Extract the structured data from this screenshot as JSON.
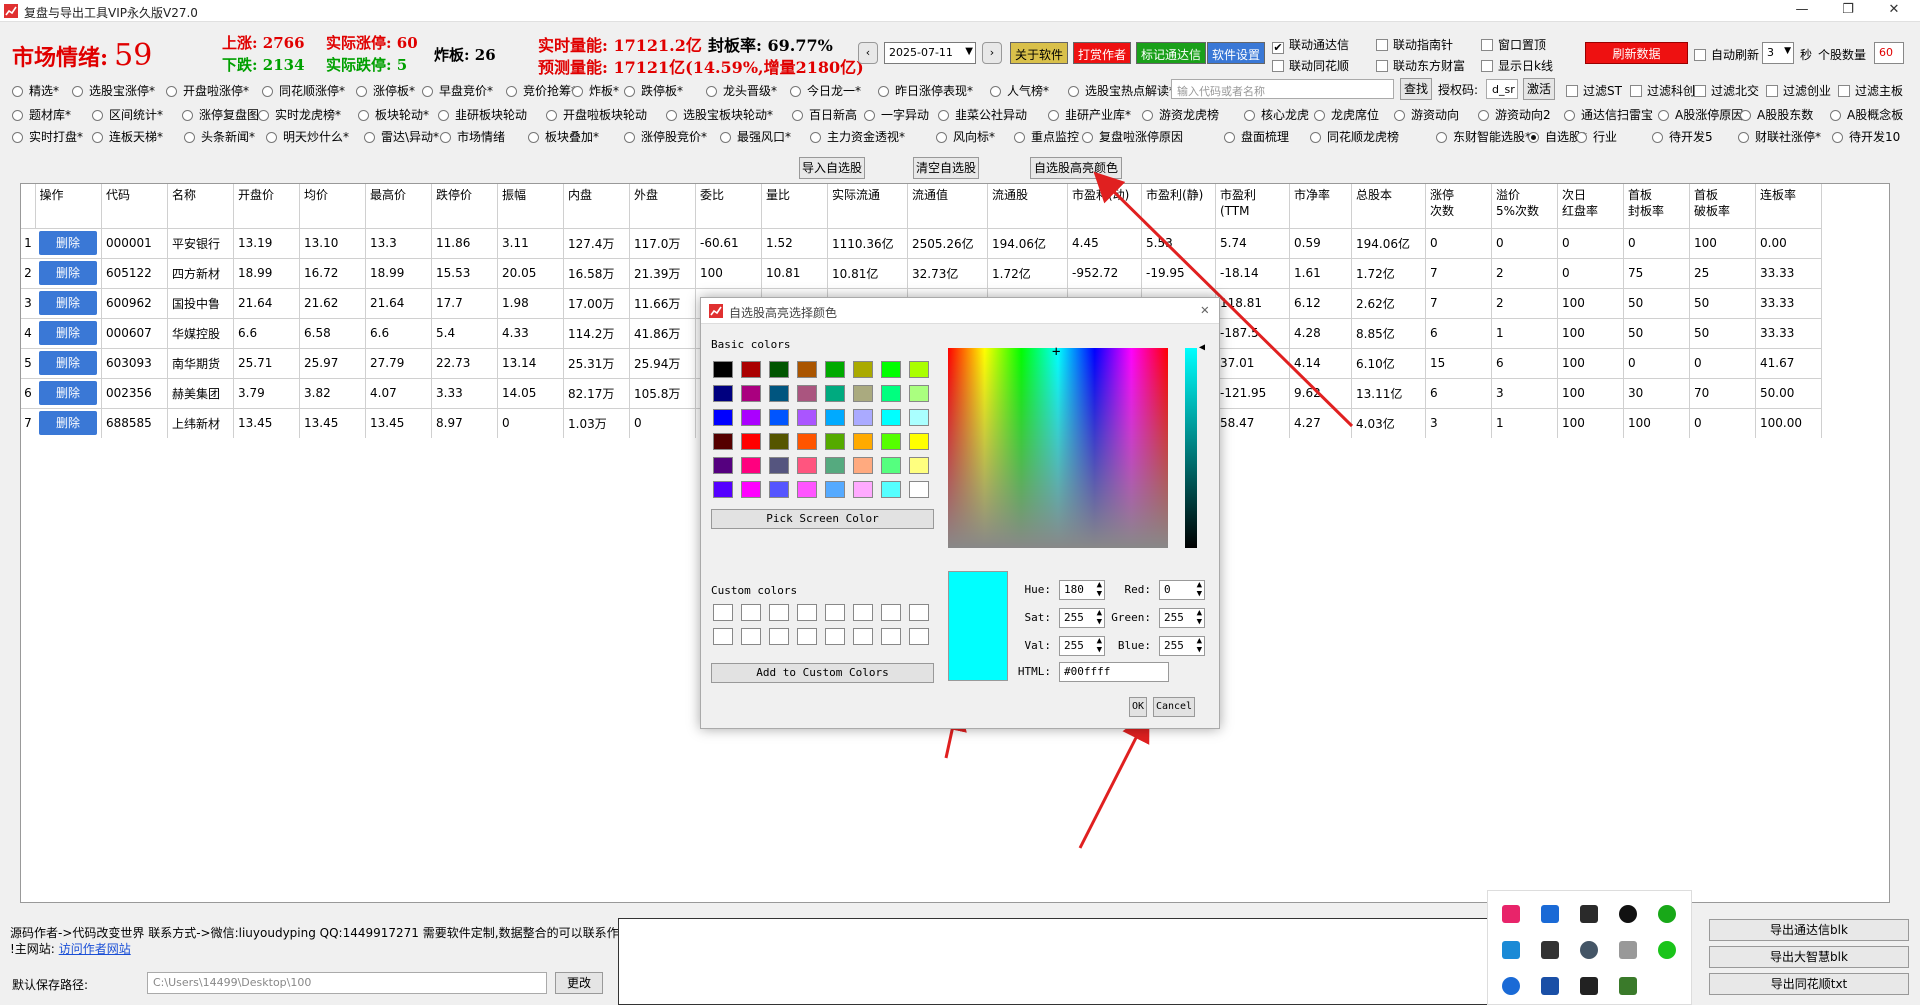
{
  "window": {
    "title": "复盘与导出工具VIP永久版V27.0"
  },
  "stats": {
    "market_label": "市场情绪:",
    "market_value": "59",
    "up": "上涨: 2766",
    "real_limit_up": "实际涨停: 60",
    "down": "下跌: 2134",
    "real_limit_down": "实际跌停: 5",
    "broken_board": "炸板: 26",
    "realtime_volume": "实时量能: 17121.2亿",
    "seal_rate": "封板率: 69.77%",
    "forecast_volume": "预测量能: 17121亿(14.59%,增量2180亿)"
  },
  "toolbar": {
    "date": "2025-07-11",
    "prev": "‹",
    "next": "›",
    "about": "关于软件",
    "donate": "打赏作者",
    "tongdaxin": "标记通达信",
    "settings": "软件设置",
    "link_tdx": "联动通达信",
    "link_zhinan": "联动指南针",
    "window_top": "窗口置顶",
    "refresh": "刷新数据",
    "auto_refresh": "自动刷新",
    "interval": "3",
    "seconds": "秒",
    "stock_count_label": "个股数量",
    "stock_count": "60",
    "link_ths": "联动同花顺",
    "link_dfcf": "联动东方财富",
    "show_kline": "显示日k线"
  },
  "radio_rows": [
    [
      "精选*",
      "选股宝涨停*",
      "开盘啦涨停*",
      "同花顺涨停*",
      "涨停板*",
      "早盘竞价*",
      "竞价抢筹*",
      "炸板*",
      "跌停板*",
      "龙头晋级*",
      "今日龙一*",
      "昨日涨停表现*",
      "人气榜*",
      "选股宝热点解读*"
    ],
    [
      "题材库*",
      "区间统计*",
      "涨停复盘图",
      "实时龙虎榜*",
      "板块轮动*",
      "韭研板块轮动",
      "开盘啦板块轮动",
      "选股宝板块轮动*",
      "百日新高",
      "一字异动",
      "韭菜公社异动",
      "韭研产业库*",
      "游资龙虎榜",
      "核心龙虎",
      "龙虎席位",
      "游资动向",
      "游资动向2",
      "通达信扫雷宝",
      "A股涨停原因",
      "A股股东数",
      "A股概念板"
    ],
    [
      "实时打盘*",
      "连板天梯*",
      "头条新闻*",
      "明天炒什么*",
      "雷达\\异动*",
      "市场情绪",
      "板块叠加*",
      "涨停股竞价*",
      "最强风口*",
      "主力资金透视*",
      "风向标*",
      "重点监控",
      "复盘啦涨停原因",
      "盘面梳理",
      "同花顺龙虎榜",
      "东财智能选股*",
      "自选股*",
      "行业",
      "待开发5",
      "财联社涨停*",
      "待开发10"
    ]
  ],
  "search": {
    "placeholder": "输入代码或者名称",
    "button": "查找",
    "auth_label": "授权码:",
    "auth_value": "d_sr",
    "activate": "激活"
  },
  "filters": [
    "过滤ST",
    "过滤科创",
    "过滤北交",
    "过滤创业",
    "过滤主板"
  ],
  "mid_buttons": {
    "import": "导入自选股",
    "clear": "清空自选股",
    "highlight": "自选股高亮颜色"
  },
  "table": {
    "headers": [
      "操作",
      "代码",
      "名称",
      "开盘价",
      "均价",
      "最高价",
      "跌停价",
      "振幅",
      "内盘",
      "外盘",
      "委比",
      "量比",
      "实际流通",
      "流通值",
      "流通股",
      "市盈利(动)",
      "市盈利(静)",
      "市盈利(TTM",
      "市净率",
      "总股本",
      "涨停\n次数",
      "溢价\n5%次数",
      "次日\n红盘率",
      "首板\n封板率",
      "首板\n破板率",
      "连板率"
    ],
    "delete_label": "删除",
    "rows": [
      [
        "1",
        "000001",
        "平安银行",
        "13.19",
        "13.10",
        "13.3",
        "11.86",
        "3.11",
        "127.4万",
        "117.0万",
        "-60.61",
        "1.52",
        "1110.36亿",
        "2505.26亿",
        "194.06亿",
        "4.45",
        "5.53",
        "5.74",
        "0.59",
        "194.06亿",
        "0",
        "0",
        "0",
        "0",
        "100",
        "0.00"
      ],
      [
        "2",
        "605122",
        "四方新材",
        "18.99",
        "16.72",
        "18.99",
        "15.53",
        "20.05",
        "16.58万",
        "21.39万",
        "100",
        "10.81",
        "10.81亿",
        "32.73亿",
        "1.72亿",
        "-952.72",
        "-19.95",
        "-18.14",
        "1.61",
        "1.72亿",
        "7",
        "2",
        "0",
        "75",
        "25",
        "33.33"
      ],
      [
        "3",
        "600962",
        "国投中鲁",
        "21.64",
        "21.62",
        "21.64",
        "17.7",
        "1.98",
        "17.00万",
        "11.66万",
        "",
        "",
        "",
        "",
        "",
        "",
        "",
        "118.81",
        "6.12",
        "2.62亿",
        "7",
        "2",
        "100",
        "50",
        "50",
        "33.33"
      ],
      [
        "4",
        "000607",
        "华媒控股",
        "6.6",
        "6.58",
        "6.6",
        "5.4",
        "4.33",
        "114.2万",
        "41.86万",
        "",
        "",
        "",
        "",
        "",
        "",
        "",
        "-187.5",
        "4.28",
        "8.85亿",
        "6",
        "1",
        "100",
        "50",
        "50",
        "33.33"
      ],
      [
        "5",
        "603093",
        "南华期货",
        "25.71",
        "25.97",
        "27.79",
        "22.73",
        "13.14",
        "25.31万",
        "25.94万",
        "",
        "",
        "",
        "",
        "",
        "",
        "",
        "37.01",
        "4.14",
        "6.10亿",
        "15",
        "6",
        "100",
        "0",
        "0",
        "41.67"
      ],
      [
        "6",
        "002356",
        "赫美集团",
        "3.79",
        "3.82",
        "4.07",
        "3.33",
        "14.05",
        "82.17万",
        "105.8万",
        "",
        "",
        "",
        "",
        "",
        "",
        "",
        "-121.95",
        "9.62",
        "13.11亿",
        "6",
        "3",
        "100",
        "30",
        "70",
        "50.00"
      ],
      [
        "7",
        "688585",
        "上纬新材",
        "13.45",
        "13.45",
        "13.45",
        "8.97",
        "0",
        "1.03万",
        "0",
        "",
        "",
        "",
        "",
        "",
        "",
        "",
        "58.47",
        "4.27",
        "4.03亿",
        "3",
        "1",
        "100",
        "100",
        "0",
        "100.00"
      ]
    ]
  },
  "dialog": {
    "title": "自选股高亮选择颜色",
    "basic_colors": "Basic colors",
    "pick_screen": "Pick Screen Color",
    "custom_colors": "Custom colors",
    "add_custom": "Add to Custom Colors",
    "hue_label": "Hue:",
    "hue": "180",
    "sat_label": "Sat:",
    "sat": "255",
    "val_label": "Val:",
    "val": "255",
    "red_label": "Red:",
    "red": "0",
    "green_label": "Green:",
    "green": "255",
    "blue_label": "Blue:",
    "blue": "255",
    "html_label": "HTML:",
    "html": "#00ffff",
    "ok": "OK",
    "cancel": "Cancel",
    "current_color": "#00ffff",
    "swatches": [
      "#000000",
      "#aa0000",
      "#005500",
      "#aa5500",
      "#00aa00",
      "#aaaa00",
      "#00ff00",
      "#aaff00",
      "#00007f",
      "#aa007f",
      "#00557f",
      "#aa557f",
      "#00aa7f",
      "#aaaa7f",
      "#00ff7f",
      "#aaff7f",
      "#0000ff",
      "#aa00ff",
      "#0055ff",
      "#aa55ff",
      "#00aaff",
      "#aaaaff",
      "#00ffff",
      "#aaffff",
      "#550000",
      "#ff0000",
      "#555500",
      "#ff5500",
      "#55aa00",
      "#ffaa00",
      "#55ff00",
      "#ffff00",
      "#55007f",
      "#ff007f",
      "#55557f",
      "#ff557f",
      "#55aa7f",
      "#ffaa7f",
      "#55ff7f",
      "#ffff7f",
      "#5500ff",
      "#ff00ff",
      "#5555ff",
      "#ff55ff",
      "#55aaff",
      "#ffaaff",
      "#55ffff",
      "#ffffff"
    ]
  },
  "footer": {
    "author": "源码作者->代码改变世界 联系方式->微信:liuyoudyping QQ:1449917271 需要软件定制,数据整合的可以联系作者",
    "site_prefix": "!主网站:",
    "site_link": "访问作者网站",
    "path_label": "默认保存路径:",
    "path": "C:\\Users\\14499\\Desktop\\100",
    "change": "更改",
    "export_tdx": "导出通达信blk",
    "export_dzh": "导出大智慧blk",
    "export_ths": "导出同花顺txt"
  }
}
